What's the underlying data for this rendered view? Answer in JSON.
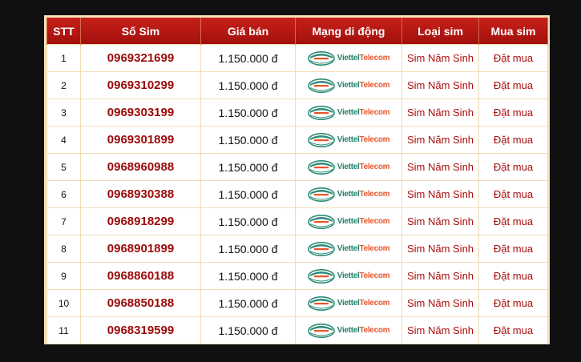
{
  "table": {
    "headers": [
      "STT",
      "Số Sim",
      "Giá bán",
      "Mạng di động",
      "Loại sim",
      "Mua sim"
    ],
    "rows": [
      {
        "stt": "1",
        "number": "0969321699",
        "price": "1.150.000 đ",
        "network": "Viettel Telecom",
        "type": "Sim Năm Sinh",
        "buy": "Đặt mua"
      },
      {
        "stt": "2",
        "number": "0969310299",
        "price": "1.150.000 đ",
        "network": "Viettel Telecom",
        "type": "Sim Năm Sinh",
        "buy": "Đặt mua"
      },
      {
        "stt": "3",
        "number": "0969303199",
        "price": "1.150.000 đ",
        "network": "Viettel Telecom",
        "type": "Sim Năm Sinh",
        "buy": "Đặt mua"
      },
      {
        "stt": "4",
        "number": "0969301899",
        "price": "1.150.000 đ",
        "network": "Viettel Telecom",
        "type": "Sim Năm Sinh",
        "buy": "Đặt mua"
      },
      {
        "stt": "5",
        "number": "0968960988",
        "price": "1.150.000 đ",
        "network": "Viettel Telecom",
        "type": "Sim Năm Sinh",
        "buy": "Đặt mua"
      },
      {
        "stt": "6",
        "number": "0968930388",
        "price": "1.150.000 đ",
        "network": "Viettel Telecom",
        "type": "Sim Năm Sinh",
        "buy": "Đặt mua"
      },
      {
        "stt": "7",
        "number": "0968918299",
        "price": "1.150.000 đ",
        "network": "Viettel Telecom",
        "type": "Sim Năm Sinh",
        "buy": "Đặt mua"
      },
      {
        "stt": "8",
        "number": "0968901899",
        "price": "1.150.000 đ",
        "network": "Viettel Telecom",
        "type": "Sim Năm Sinh",
        "buy": "Đặt mua"
      },
      {
        "stt": "9",
        "number": "0968860188",
        "price": "1.150.000 đ",
        "network": "Viettel Telecom",
        "type": "Sim Năm Sinh",
        "buy": "Đặt mua"
      },
      {
        "stt": "10",
        "number": "0968850188",
        "price": "1.150.000 đ",
        "network": "Viettel Telecom",
        "type": "Sim Năm Sinh",
        "buy": "Đặt mua"
      },
      {
        "stt": "11",
        "number": "0968319599",
        "price": "1.150.000 đ",
        "network": "Viettel Telecom",
        "type": "Sim Năm Sinh",
        "buy": "Đặt mua"
      }
    ]
  },
  "colors": {
    "header_bg": "#b5160f",
    "accent_text": "#9b0a0a",
    "border": "#f1ddb4",
    "page_bg": "#101010"
  },
  "icons": {
    "network_logo": "viettel-logo-icon"
  }
}
